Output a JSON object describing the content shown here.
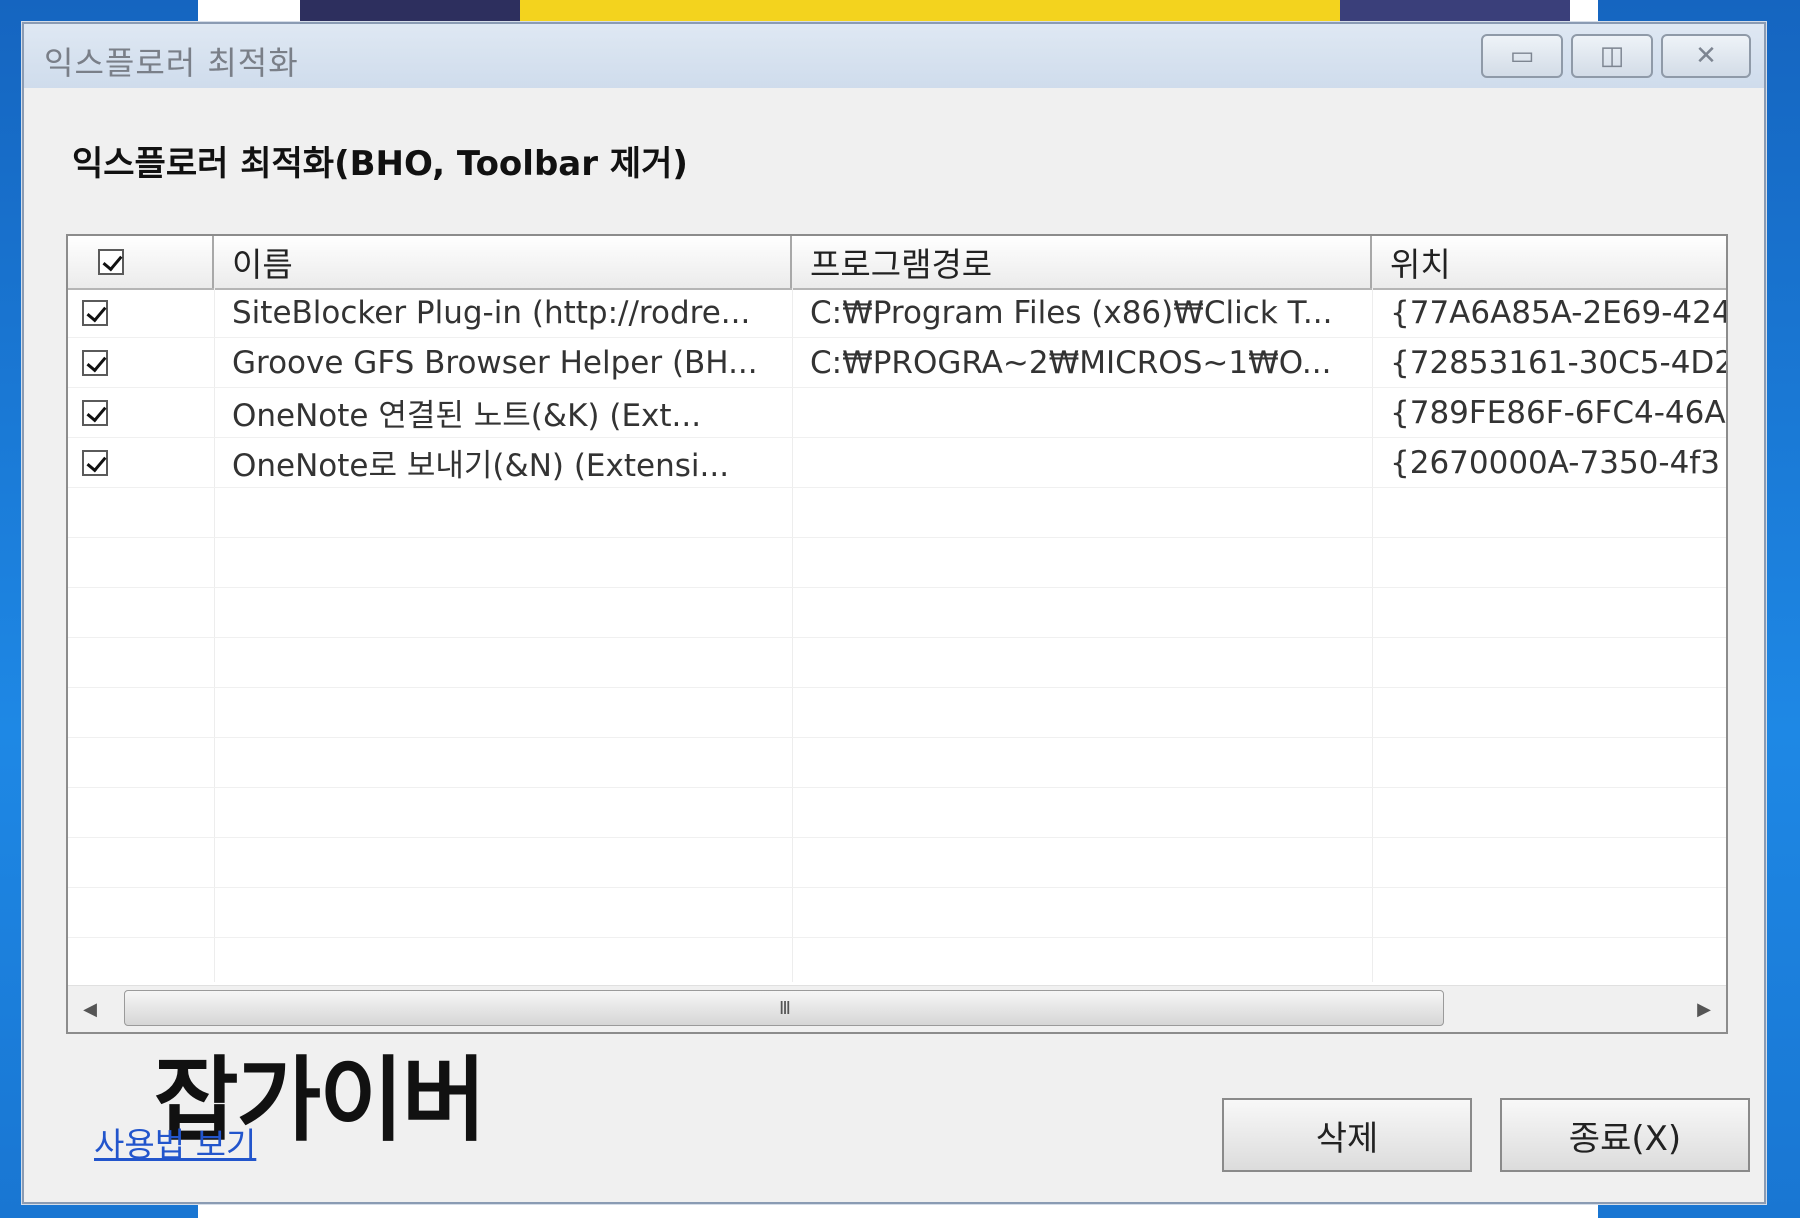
{
  "window": {
    "title": "익스플로러 최적화",
    "minimize_icon": "minimize-icon",
    "maximize_icon": "maximize-icon",
    "close_icon": "close-icon"
  },
  "heading": "익스플로러 최적화(BHO, Toolbar 제거)",
  "list": {
    "columns": [
      "이름",
      "프로그램경로",
      "위치"
    ],
    "header_checked": true,
    "rows": [
      {
        "checked": true,
        "name": "SiteBlocker Plug-in (http://rodre...",
        "path": "C:₩Program Files (x86)₩Click T...",
        "location": "{77A6A85A-2E69-424"
      },
      {
        "checked": true,
        "name": "Groove GFS Browser Helper (BH...",
        "path": "C:₩PROGRA~2₩MICROS~1₩O...",
        "location": "{72853161-30C5-4D2"
      },
      {
        "checked": true,
        "name": "OneNote 연결된 노트(&K) (Ext...",
        "path": "",
        "location": "{789FE86F-6FC4-46A"
      },
      {
        "checked": true,
        "name": "OneNote로 보내기(&N) (Extensi...",
        "path": "",
        "location": "{2670000A-7350-4f3"
      }
    ],
    "scroll_thumb_grip": "III"
  },
  "watermark": "잡가이버",
  "help_link": "사용법 보기",
  "buttons": {
    "delete": "삭제",
    "exit": "종료(X)"
  },
  "colors": {
    "dialog_bg": "#f0f0f0",
    "link": "#2255cc",
    "desktop": "#1e88e5"
  }
}
